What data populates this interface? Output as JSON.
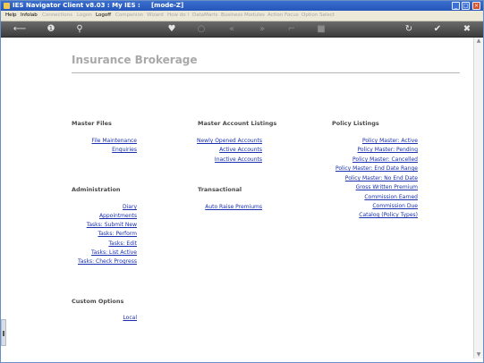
{
  "titlebar": {
    "title": "IES Navigator Client v8.03 : My IES :     [mode-Z]"
  },
  "menubar": {
    "items": [
      {
        "label": "Help",
        "enabled": true
      },
      {
        "label": "Infolab",
        "enabled": true
      },
      {
        "label": "Connections",
        "enabled": false
      },
      {
        "label": "Logon",
        "enabled": false
      },
      {
        "label": "Logoff",
        "enabled": true
      },
      {
        "label": "Companion",
        "enabled": false
      },
      {
        "label": "Wizard",
        "enabled": false
      },
      {
        "label": "How do I",
        "enabled": false
      },
      {
        "label": "DataMarts",
        "enabled": false
      },
      {
        "label": "Business Modules",
        "enabled": false
      },
      {
        "label": "Action Focus",
        "enabled": false
      },
      {
        "label": "Option Select",
        "enabled": false
      }
    ]
  },
  "toolbar": {
    "icons": [
      "back-arrow-icon",
      "info-icon",
      "search-icon",
      "heart-icon",
      "circle-icon",
      "double-left-icon",
      "double-right-icon",
      "bracket-icon",
      "stop-icon",
      "refresh-icon",
      "check-icon",
      "close-icon"
    ]
  },
  "page": {
    "title": "Insurance Brokerage"
  },
  "sections": {
    "master_files": {
      "heading": "Master Files",
      "links": [
        "File Maintenance",
        "Enquiries"
      ]
    },
    "master_account_listings": {
      "heading": "Master Account Listings",
      "links": [
        "Newly Opened Accounts",
        "Active Accounts",
        "Inactive Accounts"
      ]
    },
    "policy_listings": {
      "heading": "Policy Listings",
      "links": [
        "Policy Master: Active",
        "Policy Master: Pending",
        "Policy Master: Cancelled",
        "Policy Master: End Date Range",
        "Policy Master: No End Date",
        "Gross Written Premium",
        "Commission Earned",
        "Commission Due",
        "Catalog (Policy Types)"
      ]
    },
    "administration": {
      "heading": "Administration",
      "links": [
        "Diary",
        "Appointments",
        "Tasks: Submit New",
        "Tasks: Perform",
        "Tasks: Edit",
        "Tasks: List Active",
        "Tasks: Check Progress"
      ]
    },
    "transactional": {
      "heading": "Transactional",
      "links": [
        "Auto Raise Premiums"
      ]
    },
    "custom_options": {
      "heading": "Custom Options",
      "links": [
        "Local"
      ]
    }
  }
}
